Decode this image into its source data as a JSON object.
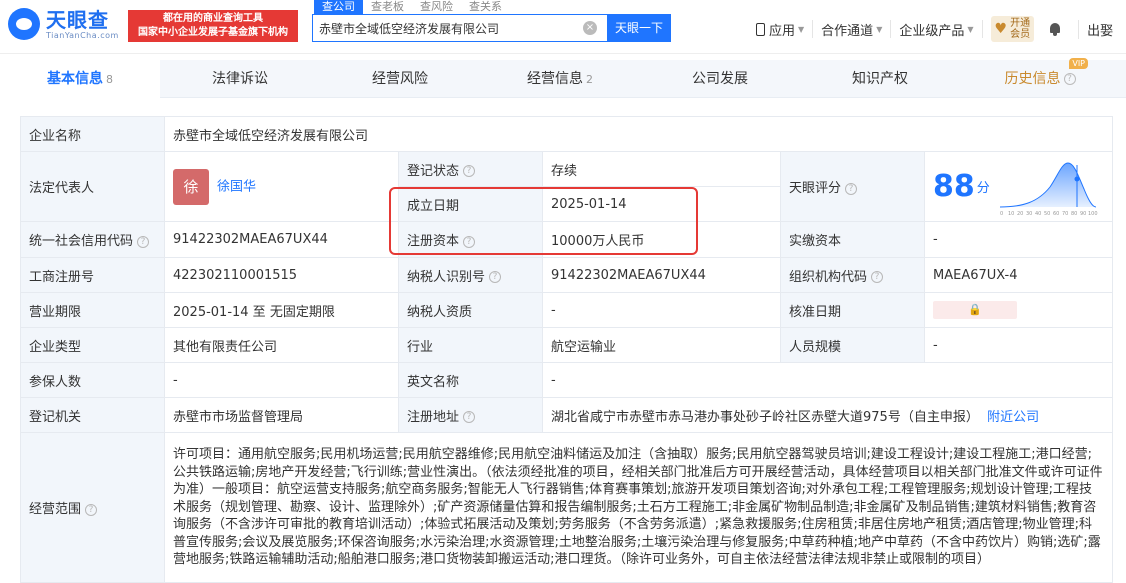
{
  "header": {
    "logo_cn": "天眼查",
    "logo_en": "TianYanCha.com",
    "slogan_line1": "都在用的商业查询工具",
    "slogan_line2": "国家中小企业发展子基金旗下机构",
    "search_tabs": [
      "查公司",
      "查老板",
      "查风险",
      "查关系"
    ],
    "search_value": "赤壁市全域低空经济发展有限公司",
    "search_button": "天眼一下",
    "nav": [
      "应用",
      "合作通道",
      "企业级产品"
    ],
    "vip_line1": "开通",
    "vip_line2": "会员",
    "user": "出娶"
  },
  "tabs": [
    {
      "label": "基本信息",
      "count": "8"
    },
    {
      "label": "法律诉讼",
      "count": ""
    },
    {
      "label": "经营风险",
      "count": ""
    },
    {
      "label": "经营信息",
      "count": "2"
    },
    {
      "label": "公司发展",
      "count": ""
    },
    {
      "label": "知识产权",
      "count": ""
    },
    {
      "label": "历史信息",
      "count": "",
      "badge": "VIP"
    }
  ],
  "table": {
    "company_name_label": "企业名称",
    "company_name": "赤壁市全域低空经济发展有限公司",
    "legal_rep_label": "法定代表人",
    "legal_rep_avatar": "徐",
    "legal_rep": "徐国华",
    "reg_status_label": "登记状态",
    "reg_status": "存续",
    "tianyan_score_label": "天眼评分",
    "score": "88",
    "score_unit": "分",
    "found_date_label": "成立日期",
    "found_date": "2025-01-14",
    "reg_capital_label": "注册资本",
    "reg_capital": "10000万人民币",
    "paid_capital_label": "实缴资本",
    "paid_capital": "-",
    "credit_code_label": "统一社会信用代码",
    "credit_code": "91422302MAEA67UX44",
    "biz_reg_no_label": "工商注册号",
    "biz_reg_no": "422302110001515",
    "taxpayer_id_label": "纳税人识别号",
    "taxpayer_id": "91422302MAEA67UX44",
    "org_code_label": "组织机构代码",
    "org_code": "MAEA67UX-4",
    "term_label": "营业期限",
    "term": "2025-01-14 至 无固定期限",
    "taxpayer_qual_label": "纳税人资质",
    "taxpayer_qual": "-",
    "approve_date_label": "核准日期",
    "company_type_label": "企业类型",
    "company_type": "其他有限责任公司",
    "industry_label": "行业",
    "industry": "航空运输业",
    "staff_size_label": "人员规模",
    "staff_size": "-",
    "insured_label": "参保人数",
    "insured": "-",
    "english_name_label": "英文名称",
    "english_name": "-",
    "reg_authority_label": "登记机关",
    "reg_authority": "赤壁市市场监督管理局",
    "reg_address_label": "注册地址",
    "reg_address": "湖北省咸宁市赤壁市赤马港办事处砂子岭社区赤壁大道975号（自主申报）",
    "nearby_link": "附近公司",
    "scope_label": "经营范围",
    "scope": "许可项目：通用航空服务;民用机场运营;民用航空器维修;民用航空油料储运及加注（含抽取）服务;民用航空器驾驶员培训;建设工程设计;建设工程施工;港口经营;公共铁路运输;房地产开发经营;飞行训练;营业性演出。（依法须经批准的项目，经相关部门批准后方可开展经营活动，具体经营项目以相关部门批准文件或许可证件为准）一般项目：航空运营支持服务;航空商务服务;智能无人飞行器销售;体育赛事策划;旅游开发项目策划咨询;对外承包工程;工程管理服务;规划设计管理;工程技术服务（规划管理、勘察、设计、监理除外）;矿产资源储量估算和报告编制服务;土石方工程施工;非金属矿物制品制造;非金属矿及制品销售;建筑材料销售;教育咨询服务（不含涉许可审批的教育培训活动）;体验式拓展活动及策划;劳务服务（不含劳务派遣）;紧急救援服务;住房租赁;非居住房地产租赁;酒店管理;物业管理;科普宣传服务;会议及展览服务;环保咨询服务;水污染治理;水资源管理;土地整治服务;土壤污染治理与修复服务;中草药种植;地产中草药（不含中药饮片）购销;选矿;露营地服务;铁路运输辅助活动;船舶港口服务;港口货物装卸搬运活动;港口理货。（除许可业务外，可自主依法经营法律法规非禁止或限制的项目）"
  },
  "score_chart": {
    "x_ticks": [
      "0",
      "10",
      "20",
      "30",
      "40",
      "50",
      "60",
      "70",
      "80",
      "90",
      "100"
    ]
  },
  "colors": {
    "accent": "#1f75ff",
    "highlight": "#e53935",
    "status_green": "#2ea04b"
  }
}
